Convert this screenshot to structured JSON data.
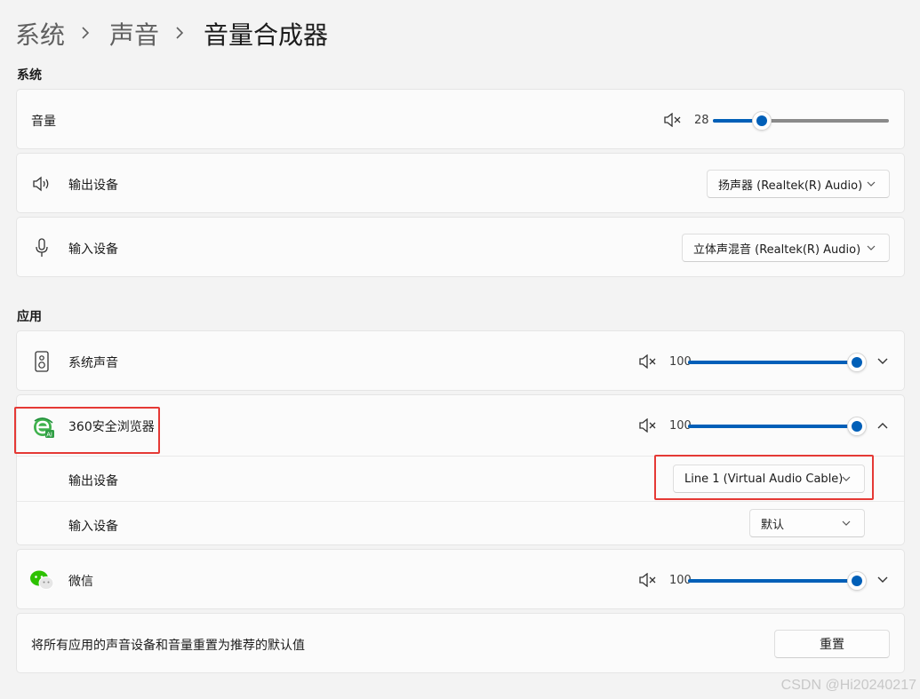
{
  "breadcrumb": {
    "items": [
      "系统",
      "声音"
    ],
    "current": "音量合成器"
  },
  "system_section": {
    "title": "系统",
    "volume": {
      "label": "音量",
      "value": "28",
      "level": 0.28
    },
    "output": {
      "label": "输出设备",
      "selected": "扬声器 (Realtek(R) Audio)"
    },
    "input": {
      "label": "输入设备",
      "selected": "立体声混音 (Realtek(R) Audio)"
    }
  },
  "apps_section": {
    "title": "应用",
    "apps": [
      {
        "name": "系统声音",
        "value": "100",
        "level": 1.0,
        "icon": "speaker-device-icon",
        "expanded": false
      },
      {
        "name": "360安全浏览器",
        "value": "100",
        "level": 1.0,
        "icon": "360-browser-icon",
        "expanded": true,
        "output_label": "输出设备",
        "output_selected": "Line 1 (Virtual Audio Cable)",
        "input_label": "输入设备",
        "input_selected": "默认"
      },
      {
        "name": "微信",
        "value": "100",
        "level": 1.0,
        "icon": "wechat-icon",
        "expanded": false
      }
    ]
  },
  "reset": {
    "label": "将所有应用的声音设备和音量重置为推荐的默认值",
    "button": "重置"
  },
  "watermark": "CSDN @Hi20240217",
  "colors": {
    "accent": "#005fb8",
    "highlight": "#e53935",
    "background": "#f3f3f3",
    "card": "#fbfbfb"
  }
}
